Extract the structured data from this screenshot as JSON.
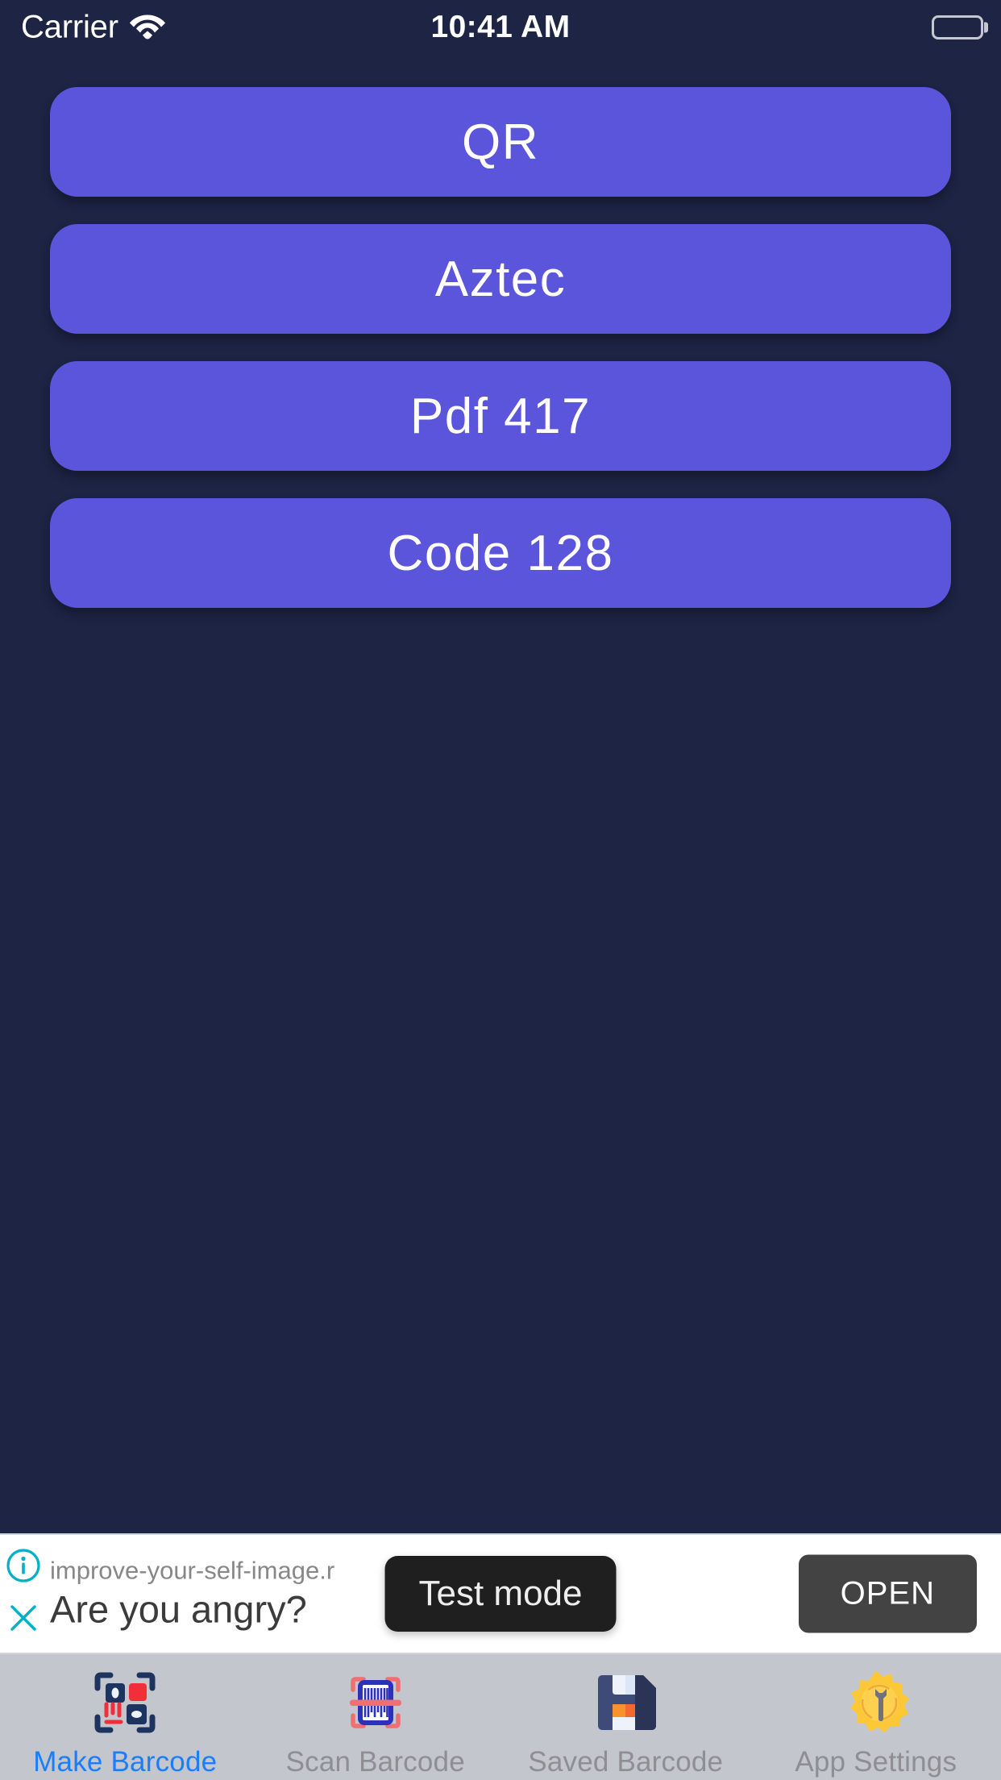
{
  "status_bar": {
    "carrier": "Carrier",
    "time": "10:41 AM",
    "wifi_icon": "wifi-icon",
    "battery_icon": "battery-icon"
  },
  "main": {
    "barcode_type_buttons": [
      {
        "label": "QR"
      },
      {
        "label": "Aztec"
      },
      {
        "label": "Pdf 417"
      },
      {
        "label": "Code 128"
      }
    ]
  },
  "ad_banner": {
    "url": "improve-your-self-image.r",
    "headline": "Are you angry?",
    "test_mode_badge": "Test mode",
    "open_label": "OPEN",
    "info_icon": "info-circle-icon",
    "close_icon": "close-x-icon"
  },
  "tab_bar": {
    "items": [
      {
        "label": "Make Barcode",
        "icon": "qr-code-icon",
        "active": true
      },
      {
        "label": "Scan Barcode",
        "icon": "barcode-scan-icon",
        "active": false
      },
      {
        "label": "Saved Barcode",
        "icon": "floppy-disk-icon",
        "active": false
      },
      {
        "label": "App Settings",
        "icon": "gear-wrench-icon",
        "active": false
      }
    ]
  },
  "colors": {
    "background": "#1d2444",
    "button_purple": "#5a55db",
    "tabbar_background": "#c3c6cd",
    "tab_active": "#1a7dfa",
    "tab_inactive": "#8e8e93",
    "ad_accent_cyan": "#00b0c8",
    "ad_open_button": "#434343",
    "test_mode_badge": "#1f1f1f"
  }
}
